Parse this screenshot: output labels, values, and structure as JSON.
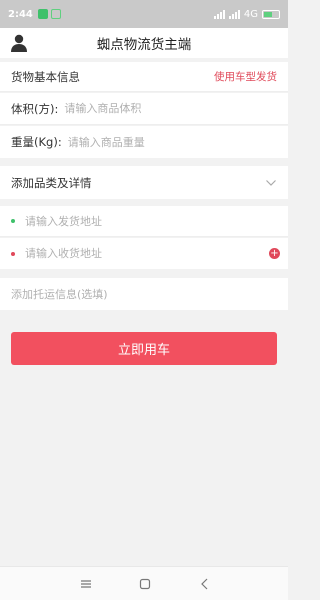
{
  "status_bar": {
    "time": "2:44",
    "network": "4G"
  },
  "header": {
    "title": "蜘点物流货主端"
  },
  "goods_info": {
    "title": "货物基本信息",
    "vehicle_link": "使用车型发货",
    "volume_label": "体积(方):",
    "volume_placeholder": "请输入商品体积",
    "weight_label": "重量(Kg):",
    "weight_placeholder": "请输入商品重量"
  },
  "category": {
    "label": "添加品类及详情"
  },
  "address": {
    "from_placeholder": "请输入发货地址",
    "to_placeholder": "请输入收货地址",
    "from_dot_color": "#3fc16b",
    "to_dot_color": "#e0485a"
  },
  "consign": {
    "placeholder": "添加托运信息(选填)"
  },
  "actions": {
    "submit_label": "立即用车"
  },
  "colors": {
    "accent": "#f2505f",
    "link": "#e04a5a"
  },
  "icons": {
    "header": "user-icon",
    "category": "chevron-down-icon",
    "add_address": "plus-icon",
    "nav": [
      "menu-icon",
      "home-icon",
      "back-icon"
    ]
  }
}
